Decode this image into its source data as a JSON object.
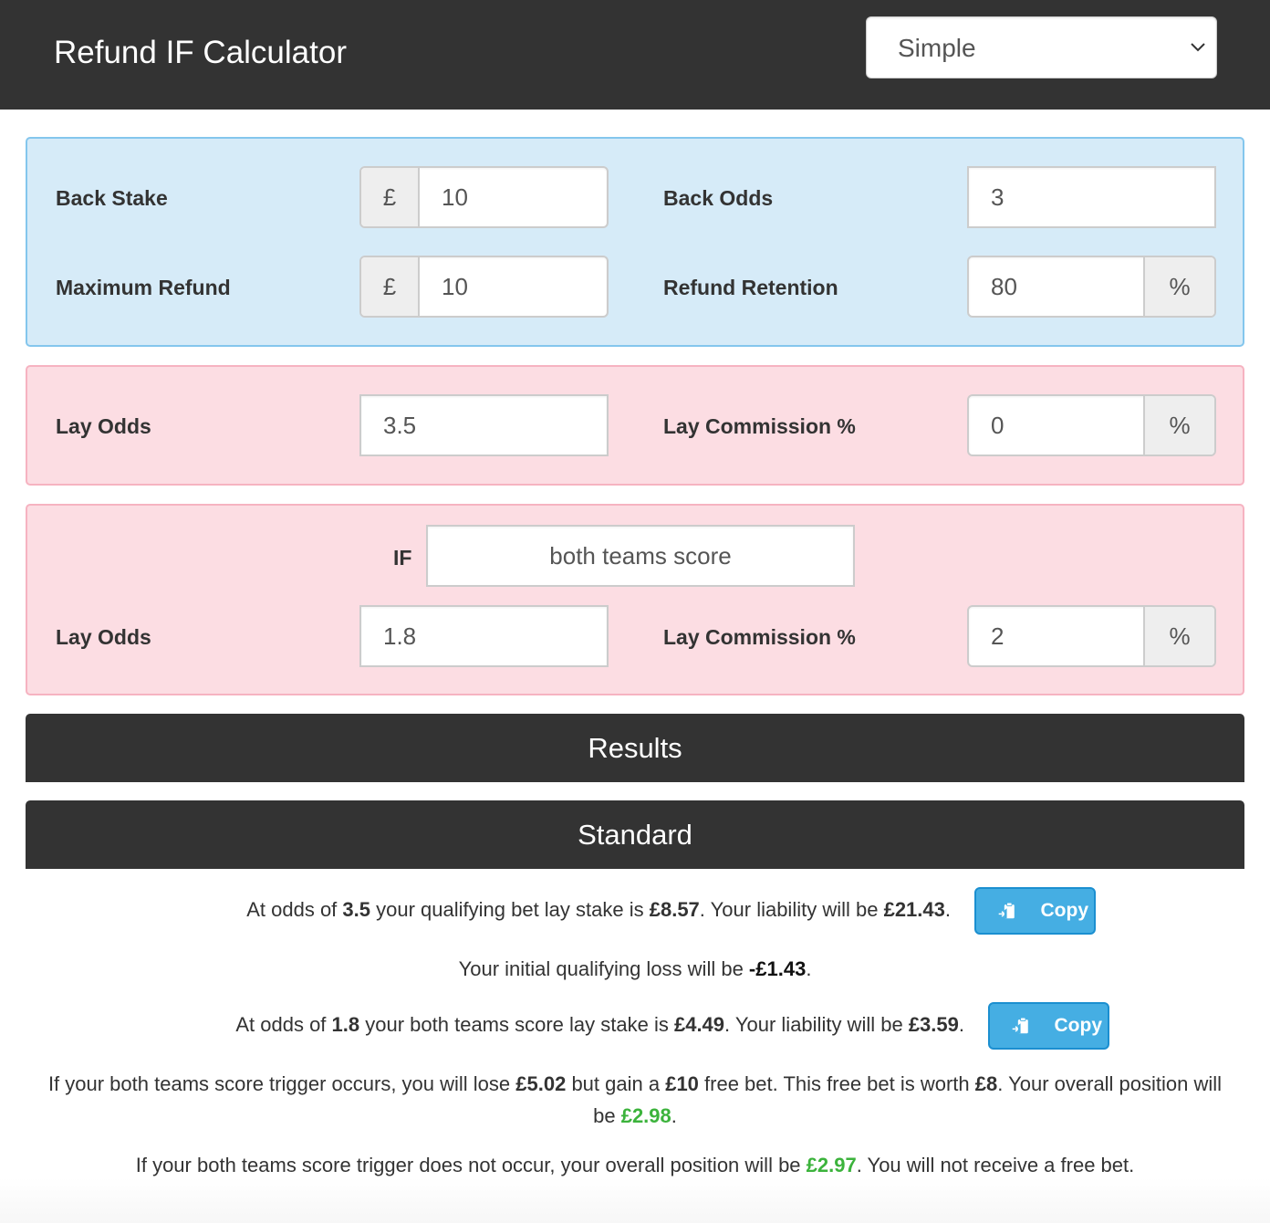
{
  "header": {
    "title": "Refund IF Calculator",
    "mode_select": {
      "selected": "Simple",
      "icon": "chevron-down-icon"
    }
  },
  "back_panel": {
    "back_stake": {
      "label": "Back Stake",
      "prefix": "£",
      "value": "10"
    },
    "back_odds": {
      "label": "Back Odds",
      "value": "3"
    },
    "maximum_refund": {
      "label": "Maximum Refund",
      "prefix": "£",
      "value": "10"
    },
    "refund_retention": {
      "label": "Refund Retention",
      "value": "80",
      "suffix": "%"
    }
  },
  "lay_panel": {
    "lay_odds": {
      "label": "Lay Odds",
      "value": "3.5"
    },
    "lay_commission": {
      "label": "Lay Commission %",
      "value": "0",
      "suffix": "%"
    }
  },
  "if_panel": {
    "if_label": "IF",
    "trigger": {
      "value": "both teams score"
    },
    "lay_odds": {
      "label": "Lay Odds",
      "value": "1.8"
    },
    "lay_commission": {
      "label": "Lay Commission %",
      "value": "2",
      "suffix": "%"
    }
  },
  "results": {
    "title": "Results",
    "section_title": "Standard",
    "line1": {
      "t1": "At odds of ",
      "odds": "3.5",
      "t2": " your qualifying bet lay stake is ",
      "stake": "£8.57",
      "t3": ". Your liability will be ",
      "liability": "£21.43",
      "t4": "."
    },
    "copy1": {
      "label": "Copy",
      "icon": "clipboard-paste-icon"
    },
    "line2": {
      "t1": "Your initial qualifying loss will be ",
      "loss": "-£1.43",
      "t2": "."
    },
    "line3": {
      "t1": "At odds of ",
      "odds": "1.8",
      "t2": " your both teams score lay stake is ",
      "stake": "£4.49",
      "t3": ". Your liability will be ",
      "liability": "£3.59",
      "t4": "."
    },
    "copy2": {
      "label": "Copy",
      "icon": "clipboard-paste-icon"
    },
    "line4": {
      "t1": "If your both teams score trigger occurs, you will lose ",
      "lose": "£5.02",
      "t2": " but gain a ",
      "free_bet": "£10",
      "t3": " free bet. This free bet is worth ",
      "worth": "£8",
      "t4": ". Your overall position will be ",
      "position": "£2.98",
      "t5": "."
    },
    "line5": {
      "t1": "If your both teams score trigger does not occur, your overall position will be ",
      "position": "£2.97",
      "t2": ". You will not receive a free bet."
    }
  },
  "colors": {
    "header_bg": "#333333",
    "back_panel_bg": "#d6ebf8",
    "lay_panel_bg": "#fcdde3",
    "copy_button": "#45aee3",
    "positive_value": "#3cb33c"
  }
}
